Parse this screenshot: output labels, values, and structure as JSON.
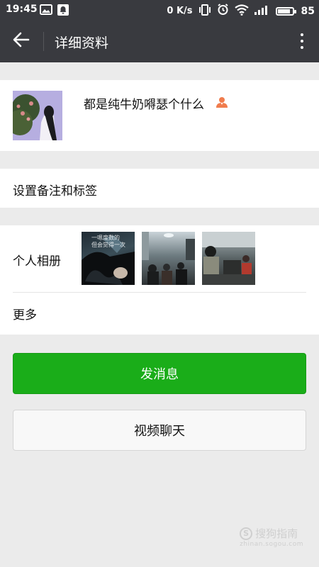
{
  "status_bar": {
    "time": "19:45",
    "net_speed": "0 K/s",
    "battery": "85",
    "battery_level": 0.85
  },
  "header": {
    "title": "详细资料",
    "back_icon": "arrow-left-icon",
    "menu_icon": "more-vertical-icon"
  },
  "profile": {
    "nickname": "都是纯牛奶嘚瑟个什么",
    "gender_icon": "user-icon",
    "gender_icon_color": "#f07c4d"
  },
  "remark": {
    "label": "设置备注和标签"
  },
  "album": {
    "label": "个人相册",
    "photos": [
      {
        "caption_line1": "一嗯度数的",
        "caption_line2": "但会觉得一次"
      },
      {},
      {}
    ]
  },
  "more": {
    "label": "更多"
  },
  "actions": {
    "send_message": "发消息",
    "video_chat": "视频聊天",
    "primary_color": "#1aad19"
  },
  "watermark": {
    "brand": "搜狗指南",
    "url": "zhinan.sogou.com"
  }
}
